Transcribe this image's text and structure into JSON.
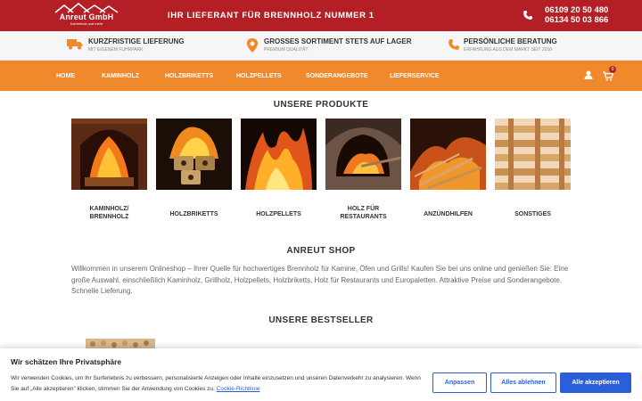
{
  "header": {
    "logo_name": "Anreut GmbH",
    "logo_sub": "Kaminholz und mehr",
    "slogan": "IHR LIEFERANT FÜR BRENNHOLZ NUMMER 1",
    "phone1": "06109 20 50 480",
    "phone2": "06134 50 03 866"
  },
  "features": [
    {
      "title": "KURZFRISTIGE LIEFERUNG",
      "sub": "MIT EIGENEM FUHRPARK",
      "icon": "truck-icon"
    },
    {
      "title": "GROSSES SORTIMENT STETS AUF LAGER",
      "sub": "PREMIUM QUALITÄT",
      "icon": "location-pin-icon"
    },
    {
      "title": "PERSÖNLICHE BERATUNG",
      "sub": "ERFAHRUNG AUS DEM MARKT SEIT 2010",
      "icon": "phone-icon"
    }
  ],
  "nav": {
    "items": [
      "HOME",
      "KAMINHOLZ",
      "HOLZBRIKETTS",
      "HOLZPELLETS",
      "SONDERANGEBOTE",
      "LIEFERSERVICE"
    ],
    "cart_count": "0"
  },
  "products": {
    "title": "UNSERE PRODUKTE",
    "categories": [
      {
        "label1": "KAMINHOLZ/",
        "label2": "BRENNHOLZ"
      },
      {
        "label1": "HOLZBRIKETTS",
        "label2": ""
      },
      {
        "label1": "HOLZPELLETS",
        "label2": ""
      },
      {
        "label1": "HOLZ FÜR",
        "label2": "RESTAURANTS"
      },
      {
        "label1": "ANZÜNDHILFEN",
        "label2": ""
      },
      {
        "label1": "SONSTIGES",
        "label2": ""
      }
    ]
  },
  "shop": {
    "title": "ANREUT SHOP",
    "text": "Willkommen in unserem Onlineshop – Ihrer Quelle für hochwertiges Brennholz für Kamine, Öfen und Grills! Kaufen Sie bei uns online und genießen Sie: Eine große Auswahl, einschließlich Kaminholz, Grillholz, Holzpellets, Holzbriketts, Holz für Restaurants und Europaletten. Attraktive Preise und Sonderangebote. Schnelle Lieferung."
  },
  "bestseller": {
    "title": "UNSERE BESTSELLER"
  },
  "cookie": {
    "title": "Wir schätzen Ihre Privatsphäre",
    "text": "Wir verwenden Cookies, um Ihr Surferlebnis zu verbessern, personalisierte Anzeigen oder Inhalte einzusetzen und unseren Datenverkehr zu analysieren. Wenn Sie auf „Alle akzeptieren\" klicken, stimmen Sie der Anwendung von Cookies zu.",
    "link": "Cookie-Richtlinie",
    "btn_customize": "Anpassen",
    "btn_reject": "Alles ablehnen",
    "btn_accept": "Alle akzeptieren"
  },
  "colors": {
    "topbar": "#b31f24",
    "nav": "#f0892b",
    "accent_button": "#2b5fd9"
  }
}
